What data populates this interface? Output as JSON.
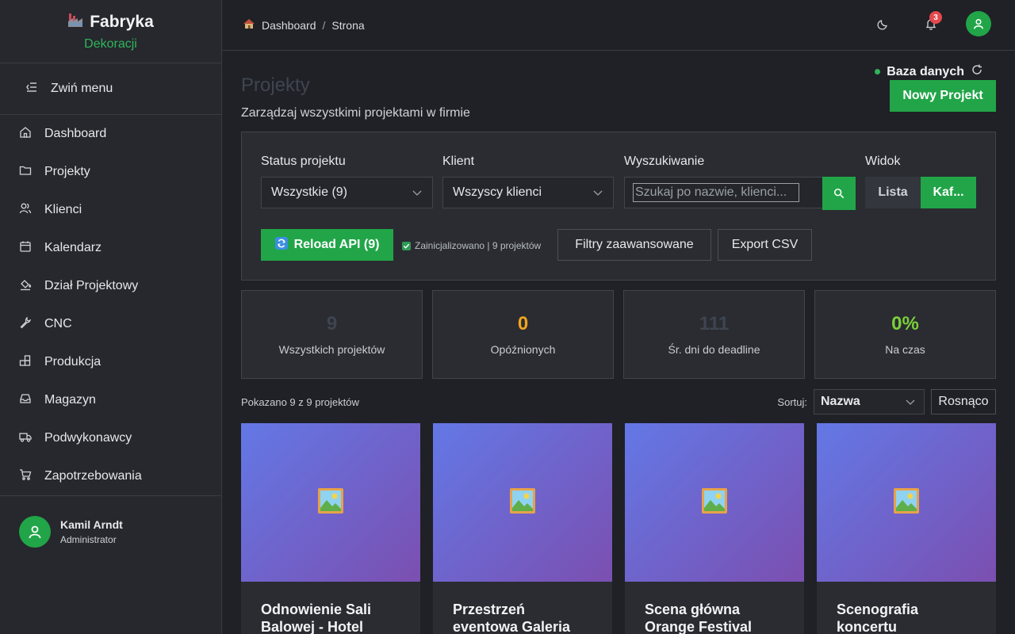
{
  "brand": {
    "name": "Fabryka",
    "sub": "Dekoracji"
  },
  "sidebar": {
    "collapse_label": "Zwiń menu",
    "items": [
      {
        "label": "Dashboard",
        "icon": "home-icon"
      },
      {
        "label": "Projekty",
        "icon": "folder-icon"
      },
      {
        "label": "Klienci",
        "icon": "users-icon"
      },
      {
        "label": "Kalendarz",
        "icon": "calendar-icon"
      },
      {
        "label": "Dział Projektowy",
        "icon": "paint-bucket-icon"
      },
      {
        "label": "CNC",
        "icon": "wrench-icon"
      },
      {
        "label": "Produkcja",
        "icon": "boxes-icon"
      },
      {
        "label": "Magazyn",
        "icon": "inbox-icon"
      },
      {
        "label": "Podwykonawcy",
        "icon": "truck-icon"
      },
      {
        "label": "Zapotrzebowania",
        "icon": "cart-icon"
      }
    ],
    "user": {
      "name": "Kamil Arndt",
      "role": "Administrator"
    }
  },
  "topbar": {
    "breadcrumb": [
      "Dashboard",
      "Strona"
    ],
    "separator": "/",
    "notifications": "3"
  },
  "header": {
    "title": "Projekty",
    "subtitle": "Zarządzaj wszystkimi projektami w firmie",
    "db_status": "Baza danych",
    "new_button": "Nowy Projekt"
  },
  "filters": {
    "status_label": "Status projektu",
    "status_value": "Wszystkie (9)",
    "client_label": "Klient",
    "client_value": "Wszyscy klienci",
    "search_label": "Wyszukiwanie",
    "search_placeholder": "Szukaj po nazwie, klienci...",
    "view_label": "Widok",
    "view_list": "Lista",
    "view_tiles": "Kaf...",
    "reload": "Reload API (9)",
    "init_text": "Zainicjalizowano | 9 projektów",
    "advanced": "Filtry zaawansowane",
    "export": "Export CSV"
  },
  "stats": [
    {
      "value": "9",
      "label": "Wszystkich projektów",
      "color": "#3f4550"
    },
    {
      "value": "0",
      "label": "Opóźnionych",
      "color": "#f0a51f"
    },
    {
      "value": "111",
      "label": "Śr. dni do deadline",
      "color": "#3f4550"
    },
    {
      "value": "0%",
      "label": "Na czas",
      "color": "#7bd03a"
    }
  ],
  "list": {
    "shown": "Pokazano 9 z 9 projektów",
    "sort_label": "Sortuj:",
    "sort_value": "Nazwa",
    "order": "Rosnąco"
  },
  "cards": [
    {
      "title_l1": "Odnowienie Sali",
      "title_l2": "Balowej - Hotel"
    },
    {
      "title_l1": "Przestrzeń",
      "title_l2": "eventowa Galeria"
    },
    {
      "title_l1": "Scena główna",
      "title_l2": "Orange Festival"
    },
    {
      "title_l1": "Scenografia",
      "title_l2": "koncertu"
    }
  ]
}
